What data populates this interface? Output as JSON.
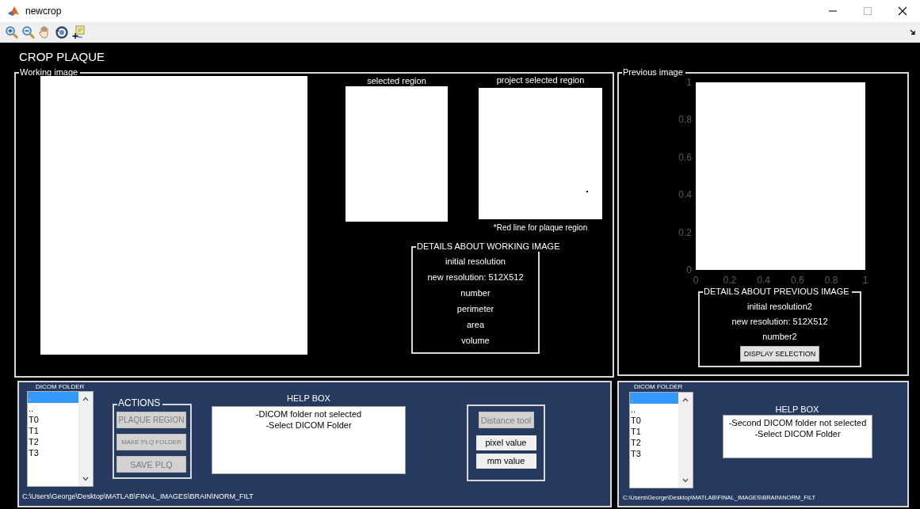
{
  "window": {
    "title": "newcrop"
  },
  "heading": "CROP PLAQUE",
  "working_panel": {
    "title": "Working image",
    "selected_region": {
      "title": "selected region"
    },
    "project_region": {
      "title": "project selected region",
      "caption": "*Red line for  plaque region"
    },
    "details": {
      "title": "DETAILS ABOUT WORKING IMAGE",
      "lines": [
        "initial resolution",
        "new resolution: 512X512",
        "number",
        "perimeter",
        "area",
        "volume"
      ]
    }
  },
  "previous_panel": {
    "title": "Previous image",
    "axes": {
      "yticks": [
        "1",
        "0.8",
        "0.6",
        "0.4",
        "0.2",
        "0"
      ],
      "xticks": [
        "0",
        "0.2",
        "0.4",
        "0.6",
        "0.8",
        "1"
      ]
    },
    "details": {
      "title": "DETAILS ABOUT PREVIOUS IMAGE",
      "lines": [
        "initial resolution2",
        "new resolution: 512X512",
        "number2"
      ],
      "button": {
        "label": "DISPLAY SELECTION",
        "disabled": false
      }
    }
  },
  "left_controls": {
    "folder_list": {
      "title": "DICOM FOLDER",
      "items": [
        {
          "label": ".",
          "selected": true
        },
        {
          "label": "..",
          "selected": false
        },
        {
          "label": "T0",
          "selected": false
        },
        {
          "label": "T1",
          "selected": false
        },
        {
          "label": "T2",
          "selected": false
        },
        {
          "label": "T3",
          "selected": false
        }
      ]
    },
    "actions": {
      "title": "ACTIONS",
      "buttons": [
        {
          "label": "PLAQUE REGION",
          "disabled": true
        },
        {
          "label": "MAKE PLQ FOLDER",
          "disabled": true
        },
        {
          "label": "SAVE PLQ",
          "disabled": true
        }
      ]
    },
    "help": {
      "title": "HELP BOX",
      "lines": [
        "-DICOM folder not selected",
        "-Select DICOM Folder"
      ]
    },
    "distance": {
      "button": {
        "label": "Distance tool",
        "disabled": true
      },
      "displays": [
        "pixel value",
        "mm value"
      ]
    },
    "path": "C:\\Users\\George\\Desktop\\MATLAB\\FINAL_IMAGES\\BRAIN\\NORM_FILT"
  },
  "right_controls": {
    "folder_list": {
      "title": "DICOM FOLDER",
      "items": [
        {
          "label": ".",
          "selected": true
        },
        {
          "label": "..",
          "selected": false
        },
        {
          "label": "T0",
          "selected": false
        },
        {
          "label": "T1",
          "selected": false
        },
        {
          "label": "T2",
          "selected": false
        },
        {
          "label": "T3",
          "selected": false
        }
      ]
    },
    "help": {
      "title": "HELP BOX",
      "lines": [
        "-Second DICOM folder not selected",
        "-Select DICOM Folder"
      ]
    },
    "path": "C:\\Users\\George\\Desktop\\MATLAB\\FINAL_IMAGES\\BRAIN\\NORM_FILT"
  }
}
